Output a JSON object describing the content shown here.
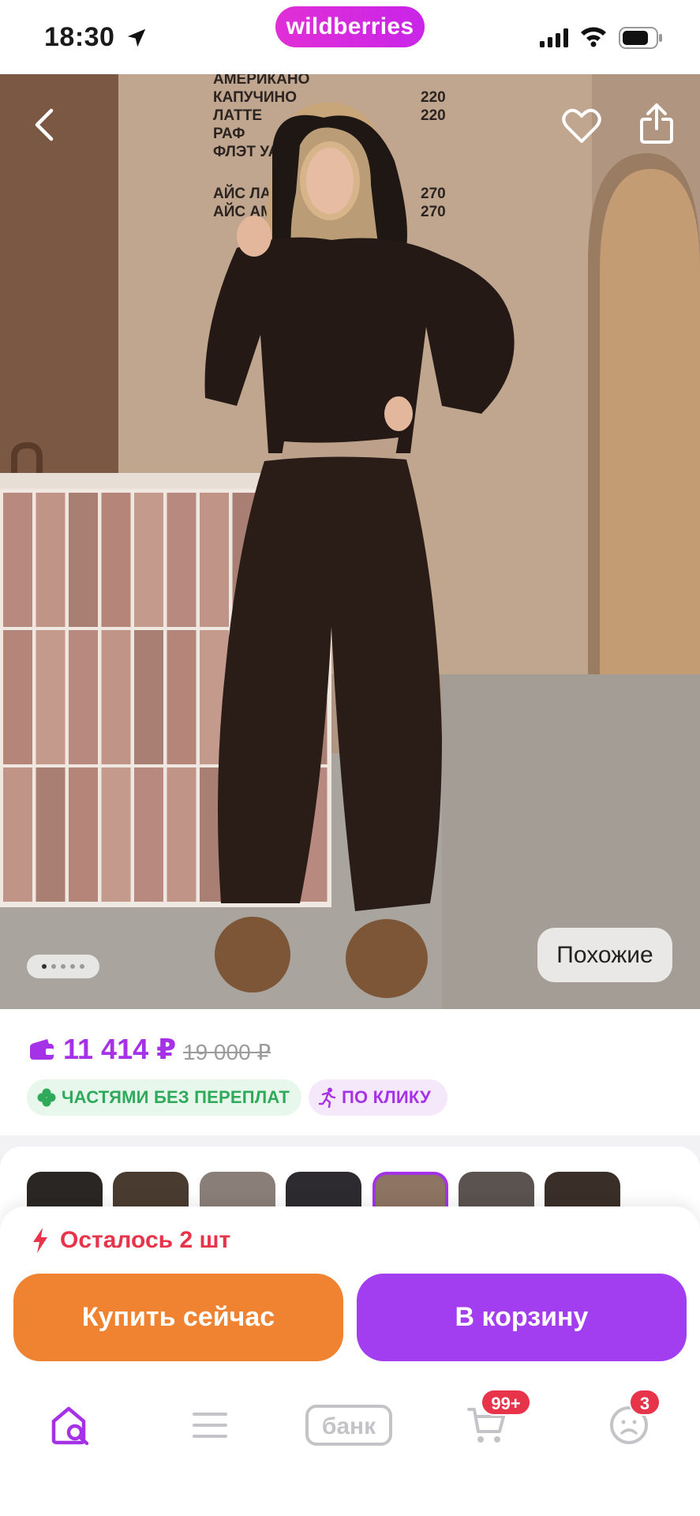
{
  "status_bar": {
    "time": "18:30",
    "app_pill": "wildberries"
  },
  "hero": {
    "menu_board": {
      "items": [
        "АМЕРИКАНО",
        "КАПУЧИНО",
        "ЛАТТЕ",
        "РАФ",
        "ФЛЭТ УАЙТ",
        "АЙС ЛАТ",
        "АЙС АМ"
      ],
      "prices": [
        "220",
        "220",
        "270",
        "270"
      ]
    },
    "similar_label": "Похожие",
    "gallery_dots": 5,
    "active_dot": 0
  },
  "price": {
    "current": "11 414 ₽",
    "old": "19 000 ₽",
    "accent_color": "#a632e8"
  },
  "badges": {
    "installments": "ЧАСТЯМИ БЕЗ ПЕРЕПЛАТ",
    "one_click": "ПО КЛИКУ"
  },
  "thumbnails": {
    "count": 7,
    "selected_index": 4
  },
  "purchase": {
    "stock_text": "Осталось 2 шт",
    "buy_now": "Купить сейчас",
    "add_to_cart": "В корзину",
    "buy_color": "#ef8331",
    "cart_color": "#a23ef0"
  },
  "tabbar": {
    "bank_label": "банк",
    "cart_badge": "99+",
    "profile_badge": "3"
  }
}
